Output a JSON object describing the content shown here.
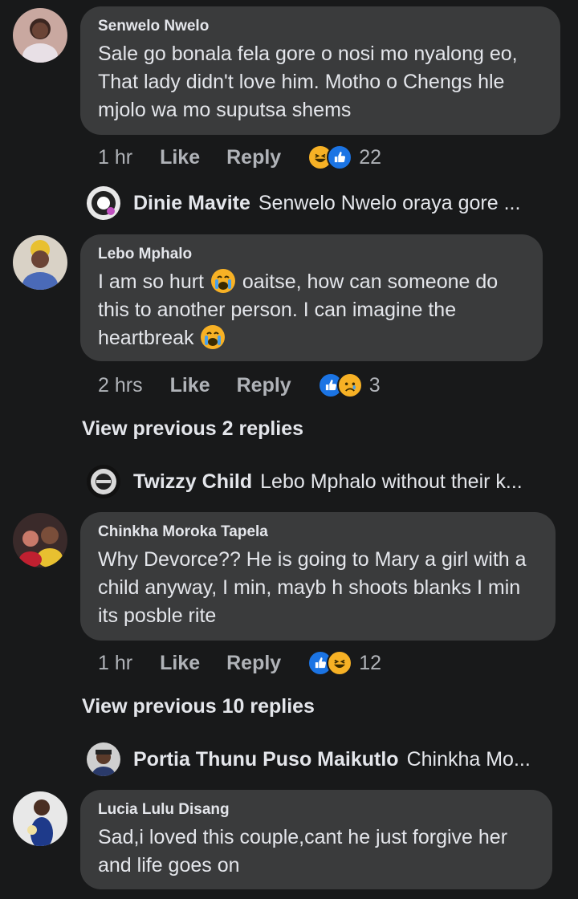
{
  "comments": [
    {
      "name": "Senwelo Nwelo",
      "text": "Sale go bonala fela gore o nosi mo nyalong eo, That lady didn't love him. Motho o Chengs hle mjolo wa mo suputsa shems",
      "time": "1 hr",
      "like_label": "Like",
      "reply_label": "Reply",
      "reactions": [
        "haha-icon",
        "like-icon"
      ],
      "reaction_count": "22"
    },
    {
      "name": "Lebo Mphalo",
      "text_parts": [
        "I am so hurt ",
        " oaitse, how can someone do this to another person. I can imagine the heartbreak "
      ],
      "inline_emoji": "crying-face-icon",
      "time": "2 hrs",
      "like_label": "Like",
      "reply_label": "Reply",
      "reactions": [
        "like-icon",
        "sad-icon"
      ],
      "reaction_count": "3"
    },
    {
      "name": "Chinkha Moroka Tapela",
      "text": "Why Devorce?? He is  going to Mary a girl with a child anyway, I min, mayb h shoots blanks I min its posble rite",
      "time": "1 hr",
      "like_label": "Like",
      "reply_label": "Reply",
      "reactions": [
        "like-icon",
        "haha-icon"
      ],
      "reaction_count": "12"
    },
    {
      "name": "Lucia Lulu Disang",
      "text": "Sad,i loved this couple,cant he just forgive her and life goes on"
    }
  ],
  "replies": [
    {
      "name": "Dinie Mavite",
      "text": "Senwelo Nwelo oraya gore ..."
    },
    {
      "name": "Twizzy Child",
      "text": "Lebo Mphalo without their k..."
    },
    {
      "name": "Portia Thunu Puso Maikutlo",
      "text": "Chinkha Mo..."
    }
  ],
  "view_previous": [
    "View previous 2 replies",
    "View previous 10 replies"
  ],
  "colors": {
    "background": "#18191a",
    "bubble": "#3a3b3c",
    "like_blue": "#1b74e4",
    "emoji_yellow": "#f7b125",
    "secondary_text": "#b0b3b8"
  }
}
